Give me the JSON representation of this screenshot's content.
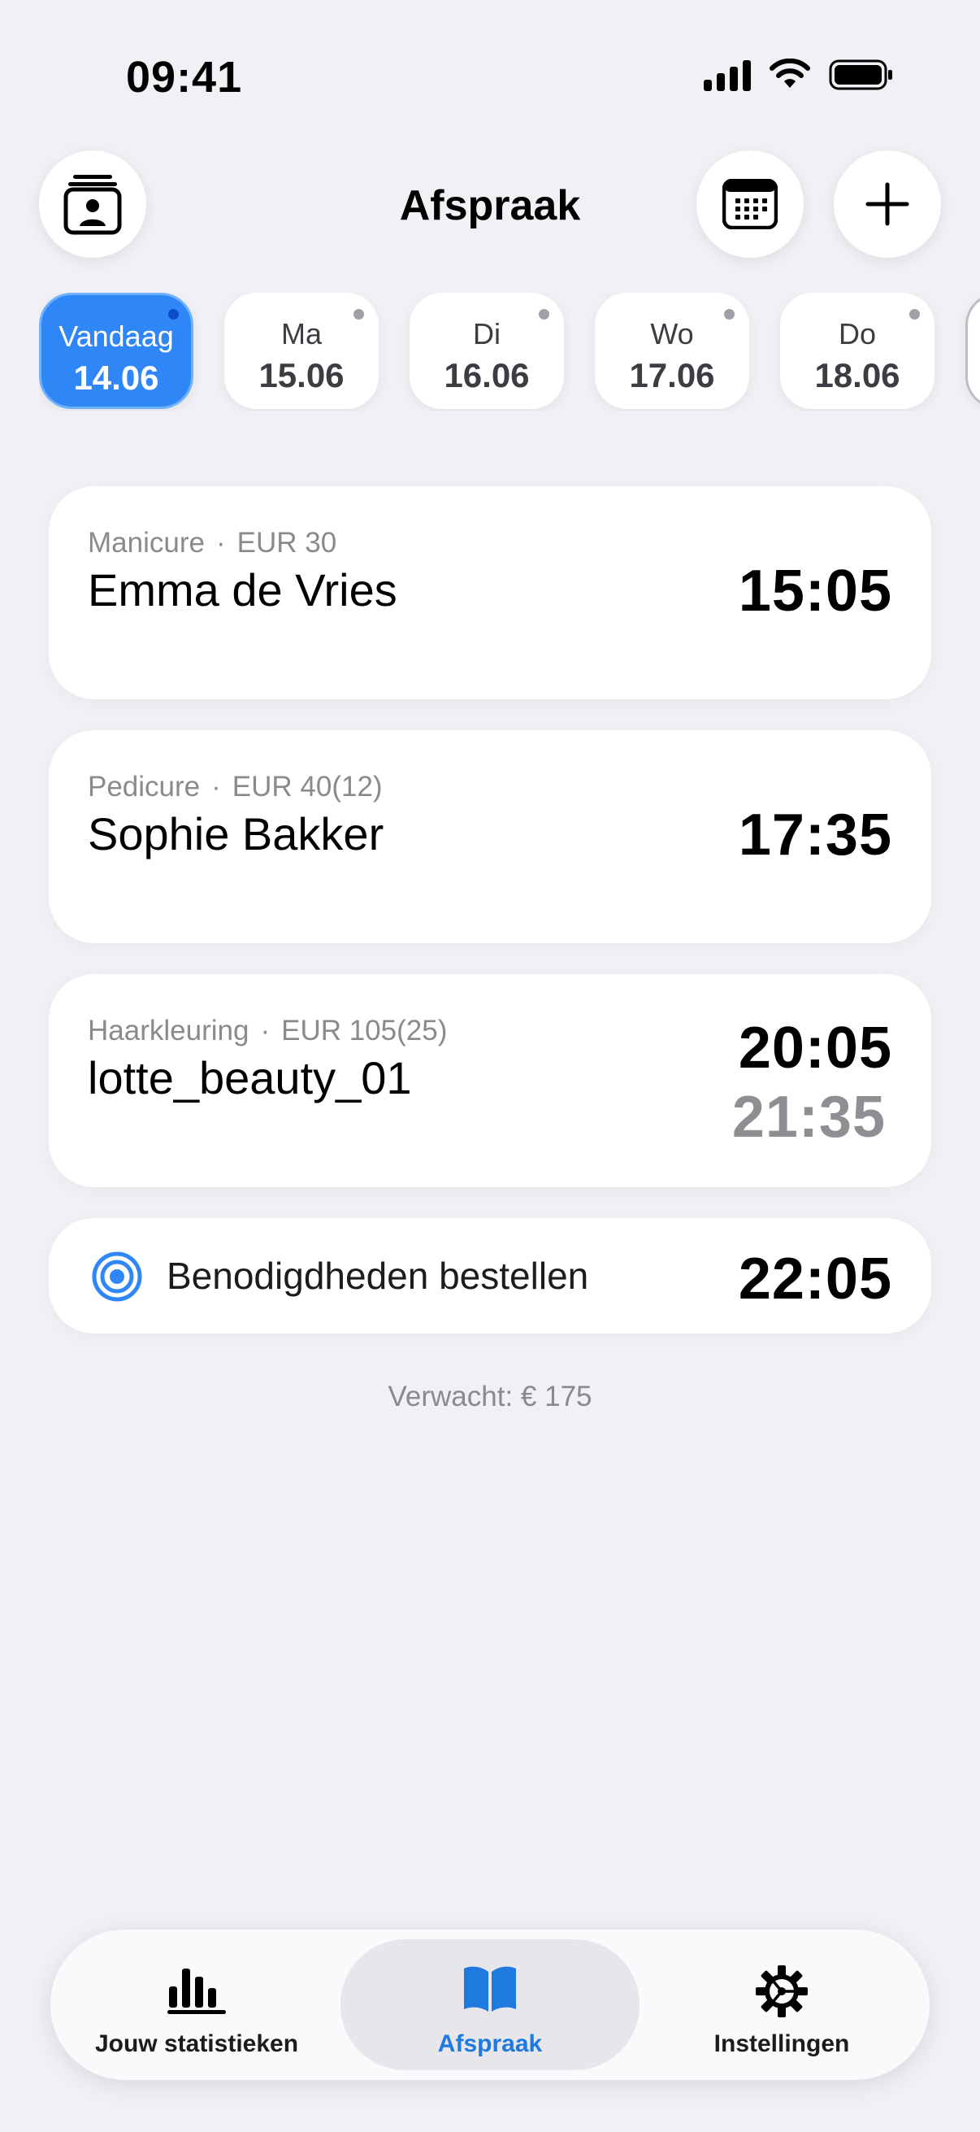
{
  "status_bar": {
    "time": "09:41"
  },
  "header": {
    "title": "Afspraak",
    "left_icon": "contacts-icon",
    "calendar_icon": "calendar-icon",
    "add_icon": "plus-icon"
  },
  "date_strip": {
    "days": [
      {
        "dow": "Vandaag",
        "date": "14.06",
        "active": true
      },
      {
        "dow": "Ma",
        "date": "15.06",
        "active": false
      },
      {
        "dow": "Di",
        "date": "16.06",
        "active": false
      },
      {
        "dow": "Wo",
        "date": "17.06",
        "active": false
      },
      {
        "dow": "Do",
        "date": "18.06",
        "active": false
      }
    ]
  },
  "appointments": [
    {
      "service": "Manicure",
      "price": "EUR 30",
      "client": "Emma de Vries",
      "start": "15:05"
    },
    {
      "service": "Pedicure",
      "price": "EUR 40(12)",
      "client": "Sophie Bakker",
      "start": "17:35"
    },
    {
      "service": "Haarkleuring",
      "price": "EUR 105(25)",
      "client": "lotte_beauty_01",
      "start": "20:05",
      "end": "21:35"
    }
  ],
  "task": {
    "label": "Benodigdheden bestellen",
    "time": "22:05",
    "icon": "target-icon"
  },
  "expected": "Verwacht: € 175",
  "tab_bar": {
    "tabs": [
      {
        "label": "Jouw statistieken",
        "icon": "bar-chart-icon",
        "active": false
      },
      {
        "label": "Afspraak",
        "icon": "book-icon",
        "active": true
      },
      {
        "label": "Instellingen",
        "icon": "gear-icon",
        "active": false
      }
    ]
  },
  "colors": {
    "accent": "#2F86F6",
    "tab_active": "#1F7AE0",
    "background": "#F0F0F5"
  }
}
